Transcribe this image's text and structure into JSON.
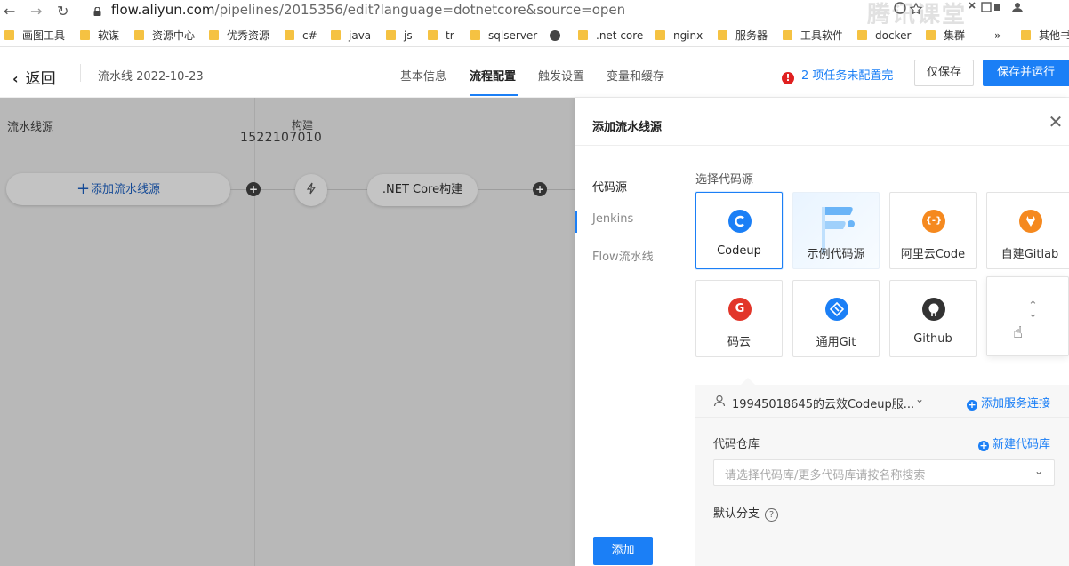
{
  "browser": {
    "url_host": "flow.aliyun.com",
    "url_path": "/pipelines/2015356/edit?language=dotnetcore&source=open",
    "watermark": "腾讯课堂",
    "bookmarks": [
      "画图工具",
      "软谋",
      "资源中心",
      "优秀资源",
      "c#",
      "java",
      "js",
      "tr",
      "sqlserver",
      ".net core",
      "nginx",
      "服务器",
      "工具软件",
      "docker",
      "集群",
      "»",
      "其他书"
    ]
  },
  "header": {
    "back_label": "返回",
    "pipeline_title": "流水线 2022-10-23",
    "tabs": [
      "基本信息",
      "流程配置",
      "触发设置",
      "变量和缓存"
    ],
    "active_tab": "流程配置",
    "warning_text": "2 项任务未配置完",
    "save_label": "仅保存",
    "save_run_label": "保存并运行"
  },
  "canvas": {
    "stage_source": "流水线源",
    "stage_build": "构建",
    "stage_number": "1522107010",
    "add_source_label": "添加流水线源",
    "build_job_label": ".NET Core构建"
  },
  "drawer": {
    "title": "添加流水线源",
    "nav": [
      "代码源",
      "Jenkins",
      "Flow流水线"
    ],
    "section_title": "选择代码源",
    "sources": [
      {
        "label": "Codeup",
        "icon": "codeup-icon",
        "color": "#1b7ff6",
        "selected": true
      },
      {
        "label": "示例代码源",
        "icon": "flow-logo-icon",
        "color": "#6ab4f7"
      },
      {
        "label": "阿里云Code",
        "icon": "aliyun-code-icon",
        "color": "#f5891f"
      },
      {
        "label": "自建Gitlab",
        "icon": "gitlab-icon",
        "color": "#f5891f"
      },
      {
        "label": "码云",
        "icon": "gitee-icon",
        "color": "#e2362a"
      },
      {
        "label": "通用Git",
        "icon": "git-icon",
        "color": "#1b7ff6"
      },
      {
        "label": "Github",
        "icon": "github-icon",
        "color": "#333333"
      }
    ],
    "connection_name": "19945018645的云效Codeup服...",
    "add_connection": "添加服务连接",
    "repo_label": "代码仓库",
    "new_repo": "新建代码库",
    "repo_placeholder": "请选择代码库/更多代码库请按名称搜索",
    "branch_label": "默认分支",
    "submit_label": "添加"
  }
}
